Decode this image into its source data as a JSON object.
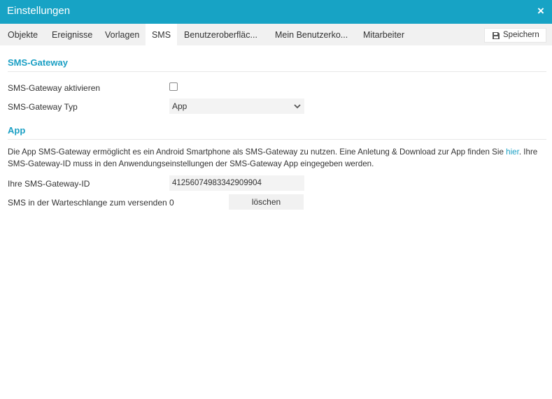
{
  "window": {
    "title": "Einstellungen",
    "close_icon": "×"
  },
  "tabs": [
    {
      "label": "Objekte"
    },
    {
      "label": "Ereignisse"
    },
    {
      "label": "Vorlagen"
    },
    {
      "label": "SMS",
      "active": true
    },
    {
      "label": "Benutzeroberfläc..."
    },
    {
      "label": "Mein Benutzerko..."
    },
    {
      "label": "Mitarbeiter"
    }
  ],
  "toolbar": {
    "save_label": "Speichern",
    "save_icon": "floppy-disk-icon"
  },
  "gateway": {
    "section_title": "SMS-Gateway",
    "activate_label": "SMS-Gateway aktivieren",
    "activate_checked": false,
    "type_label": "SMS-Gateway Typ",
    "type_value": "App"
  },
  "app": {
    "section_title": "App",
    "description_part1": "Die App SMS-Gateway ermöglicht es ein Android Smartphone als SMS-Gateway zu nutzen. Eine Anletung & Download zur App finden Sie ",
    "description_link": "hier",
    "description_part2": ". Ihre SMS-Gateway-ID muss in den Anwendungseinstellungen der SMS-Gateway App eingegeben werden.",
    "id_label": "Ihre SMS-Gateway-ID",
    "id_value": "41256074983342909904",
    "queue_label": "SMS in der Warteschlange zum versenden",
    "queue_count": "0",
    "delete_label": "löschen"
  },
  "colors": {
    "accent": "#17a3c5",
    "section_title": "#1a9fc4",
    "tabbar_bg": "#f1f1f1",
    "input_bg": "#f3f3f3"
  }
}
